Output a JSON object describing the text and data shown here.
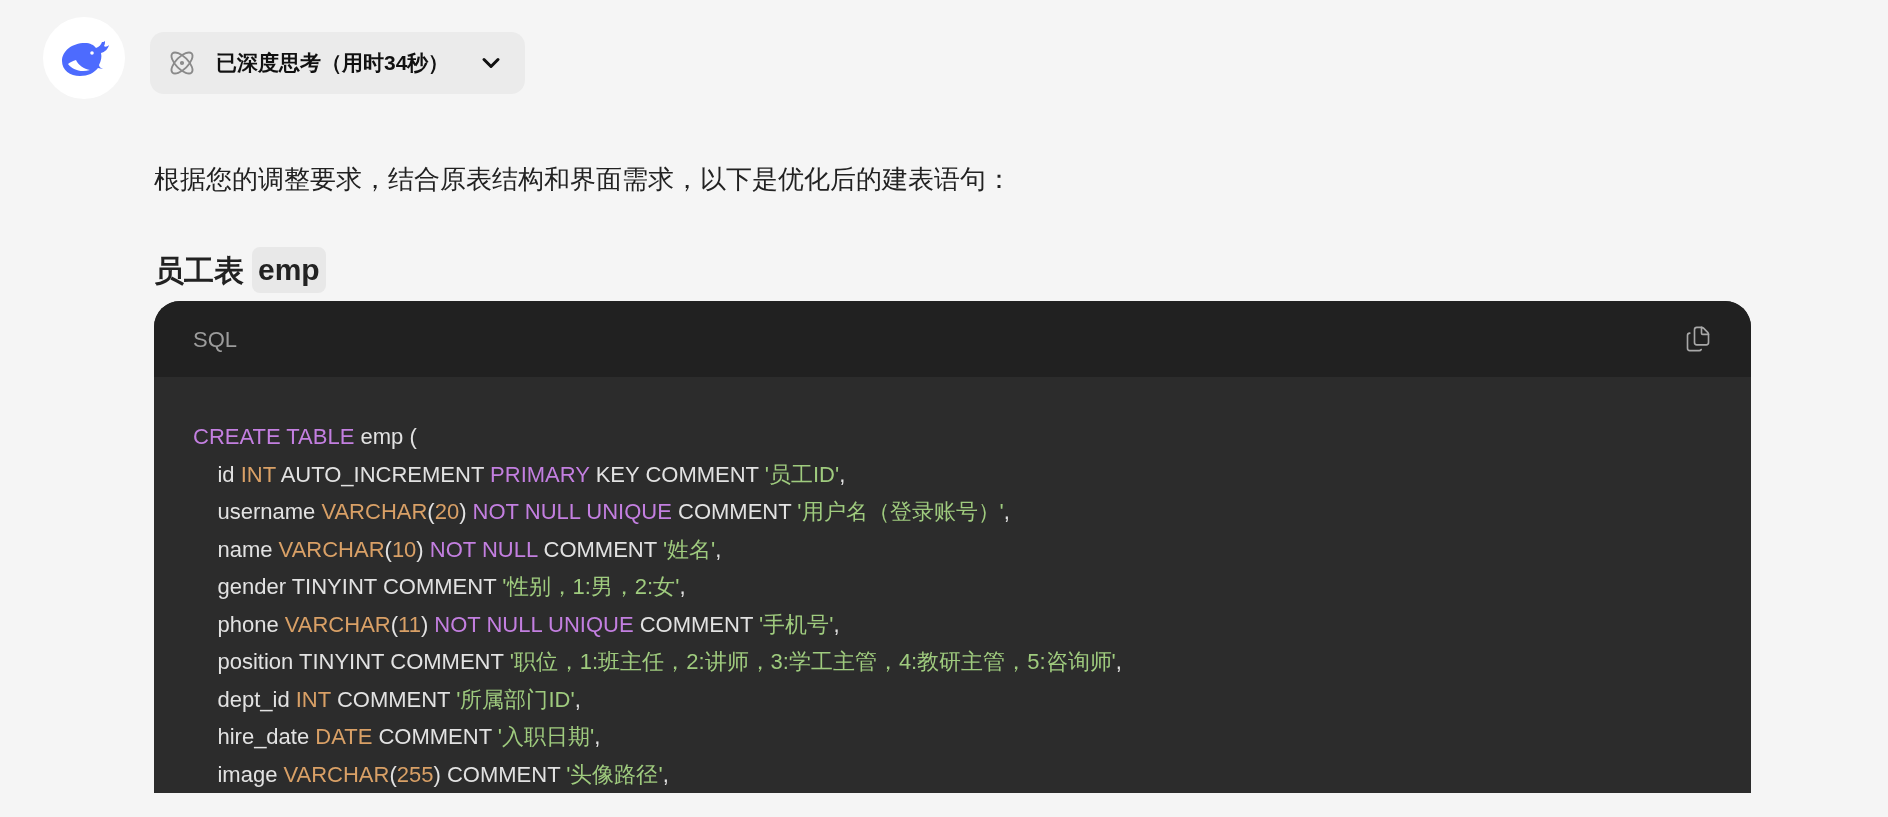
{
  "thinking": {
    "label": "已深度思考（用时34秒）",
    "expanded": false
  },
  "intro": "根据您的调整要求，结合原表结构和界面需求，以下是优化后的建表语句：",
  "heading": {
    "text": "员工表",
    "code": "emp"
  },
  "code_block": {
    "language": "SQL",
    "lines": [
      [
        {
          "kind": "keyword",
          "text": "CREATE TABLE"
        },
        {
          "kind": "plain",
          "text": " emp ("
        }
      ],
      [
        {
          "kind": "plain",
          "text": "    id "
        },
        {
          "kind": "type",
          "text": "INT"
        },
        {
          "kind": "plain",
          "text": " AUTO_INCREMENT "
        },
        {
          "kind": "keyword",
          "text": "PRIMARY"
        },
        {
          "kind": "plain",
          "text": " KEY COMMENT "
        },
        {
          "kind": "string",
          "text": "'员工ID'"
        },
        {
          "kind": "plain",
          "text": ","
        }
      ],
      [
        {
          "kind": "plain",
          "text": "    username "
        },
        {
          "kind": "type",
          "text": "VARCHAR"
        },
        {
          "kind": "plain",
          "text": "("
        },
        {
          "kind": "type",
          "text": "20"
        },
        {
          "kind": "plain",
          "text": ") "
        },
        {
          "kind": "keyword",
          "text": "NOT NULL UNIQUE"
        },
        {
          "kind": "plain",
          "text": " COMMENT "
        },
        {
          "kind": "string",
          "text": "'用户名（登录账号）'"
        },
        {
          "kind": "plain",
          "text": ","
        }
      ],
      [
        {
          "kind": "plain",
          "text": "    name "
        },
        {
          "kind": "type",
          "text": "VARCHAR"
        },
        {
          "kind": "plain",
          "text": "("
        },
        {
          "kind": "type",
          "text": "10"
        },
        {
          "kind": "plain",
          "text": ") "
        },
        {
          "kind": "keyword",
          "text": "NOT NULL"
        },
        {
          "kind": "plain",
          "text": " COMMENT "
        },
        {
          "kind": "string",
          "text": "'姓名'"
        },
        {
          "kind": "plain",
          "text": ","
        }
      ],
      [
        {
          "kind": "plain",
          "text": "    gender TINYINT COMMENT "
        },
        {
          "kind": "string",
          "text": "'性别，1:男，2:女'"
        },
        {
          "kind": "plain",
          "text": ","
        }
      ],
      [
        {
          "kind": "plain",
          "text": "    phone "
        },
        {
          "kind": "type",
          "text": "VARCHAR"
        },
        {
          "kind": "plain",
          "text": "("
        },
        {
          "kind": "type",
          "text": "11"
        },
        {
          "kind": "plain",
          "text": ") "
        },
        {
          "kind": "keyword",
          "text": "NOT NULL UNIQUE"
        },
        {
          "kind": "plain",
          "text": " COMMENT "
        },
        {
          "kind": "string",
          "text": "'手机号'"
        },
        {
          "kind": "plain",
          "text": ","
        }
      ],
      [
        {
          "kind": "plain",
          "text": "    position TINYINT COMMENT "
        },
        {
          "kind": "string",
          "text": "'职位，1:班主任，2:讲师，3:学工主管，4:教研主管，5:咨询师'"
        },
        {
          "kind": "plain",
          "text": ","
        }
      ],
      [
        {
          "kind": "plain",
          "text": "    dept_id "
        },
        {
          "kind": "type",
          "text": "INT"
        },
        {
          "kind": "plain",
          "text": " COMMENT "
        },
        {
          "kind": "string",
          "text": "'所属部门ID'"
        },
        {
          "kind": "plain",
          "text": ","
        }
      ],
      [
        {
          "kind": "plain",
          "text": "    hire_date "
        },
        {
          "kind": "type",
          "text": "DATE"
        },
        {
          "kind": "plain",
          "text": " COMMENT "
        },
        {
          "kind": "string",
          "text": "'入职日期'"
        },
        {
          "kind": "plain",
          "text": ","
        }
      ],
      [
        {
          "kind": "plain",
          "text": "    image "
        },
        {
          "kind": "type",
          "text": "VARCHAR"
        },
        {
          "kind": "plain",
          "text": "("
        },
        {
          "kind": "type",
          "text": "255"
        },
        {
          "kind": "plain",
          "text": ") COMMENT "
        },
        {
          "kind": "string",
          "text": "'头像路径'"
        },
        {
          "kind": "plain",
          "text": ","
        }
      ]
    ]
  }
}
